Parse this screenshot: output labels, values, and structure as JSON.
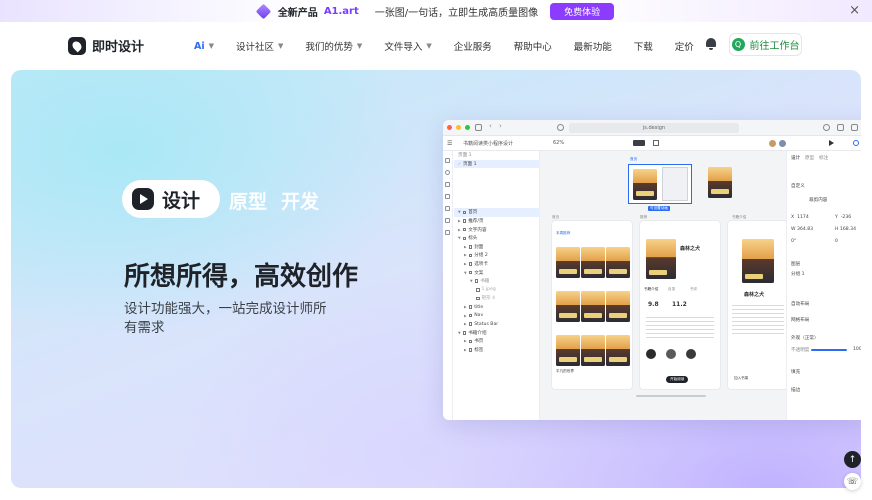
{
  "banner": {
    "new_label": "全新产品",
    "product": "A1.art",
    "slogan": "一张图/一句话，立即生成高质量图像",
    "cta": "免费体验",
    "close": "×"
  },
  "nav": {
    "brand": "即时设计",
    "items": [
      {
        "label": "Ai",
        "has_menu": true
      },
      {
        "label": "设计社区",
        "has_menu": true
      },
      {
        "label": "我们的优势",
        "has_menu": true
      },
      {
        "label": "文件导入",
        "has_menu": true
      },
      {
        "label": "企业服务",
        "has_menu": false
      },
      {
        "label": "帮助中心",
        "has_menu": false
      },
      {
        "label": "最新功能",
        "has_menu": false
      },
      {
        "label": "下载",
        "has_menu": false
      },
      {
        "label": "定价",
        "has_menu": false
      }
    ],
    "workspace": "前往工作台",
    "workspace_icon": "Q"
  },
  "hero": {
    "tags": [
      "设计",
      "原型",
      "开发"
    ],
    "headline": "所想所得，高效创作",
    "subline": "设计功能强大，一站完成设计师所有需求"
  },
  "app": {
    "url": "js.design",
    "file_name": "书籍阅读类小程序设计",
    "zoom": "62%",
    "layers_tabs": [
      "页面",
      "1"
    ],
    "page_name": "页面 1",
    "layers": [
      {
        "label": "首页",
        "level": 0,
        "selected": true
      },
      {
        "label": "推荐/页",
        "level": 0
      },
      {
        "label": "文字内容",
        "level": 0
      },
      {
        "label": "标头",
        "level": 0
      },
      {
        "label": "封面",
        "level": 1
      },
      {
        "label": "分组 2",
        "level": 1
      },
      {
        "label": "选项卡",
        "level": 1
      },
      {
        "label": "文案",
        "level": 1
      },
      {
        "label": "书籍",
        "level": 2
      },
      {
        "label": "1.jpeg",
        "level": 3
      },
      {
        "label": "矩形 4",
        "level": 3
      },
      {
        "label": "title",
        "level": 1
      },
      {
        "label": "Nav",
        "level": 1
      },
      {
        "label": "Status Bar",
        "level": 1
      },
      {
        "label": "书籍介绍",
        "level": 0
      },
      {
        "label": "书页",
        "level": 1
      },
      {
        "label": "标签",
        "level": 1
      }
    ],
    "right_tabs": [
      "设计",
      "原型",
      "标注"
    ],
    "props": {
      "frame": "自定义",
      "clip": "裁剪内容",
      "x": "1174",
      "y": "-236",
      "w": "364.83",
      "h": "168.34",
      "rotation": "0°",
      "radius": "0",
      "layer": "图层",
      "group": "分组 1",
      "auto_layout": "自动布局",
      "grid": "网格布局",
      "fill_label": "外观",
      "fill_mode": "正常",
      "opacity_label": "不透明度",
      "opacity": "100",
      "opacity_unit": "%",
      "fill": "填充",
      "stroke": "描边"
    },
    "canvas": {
      "frame_label": "首页",
      "badge": "可设置动画",
      "col_labels": [
        "首页",
        "推荐",
        "书籍介绍"
      ],
      "book_title": "森林之犬",
      "tab_labels": [
        "书籍介绍",
        "目录",
        "书评"
      ],
      "score": "9.8",
      "word_count": "11.2",
      "btn_read": "开始阅读",
      "sec_title": "本周推荐",
      "cover_caption": "平凡的世界",
      "add_shelf": "加入书架"
    }
  },
  "floating": {
    "top": "↑",
    "support": "☏"
  }
}
